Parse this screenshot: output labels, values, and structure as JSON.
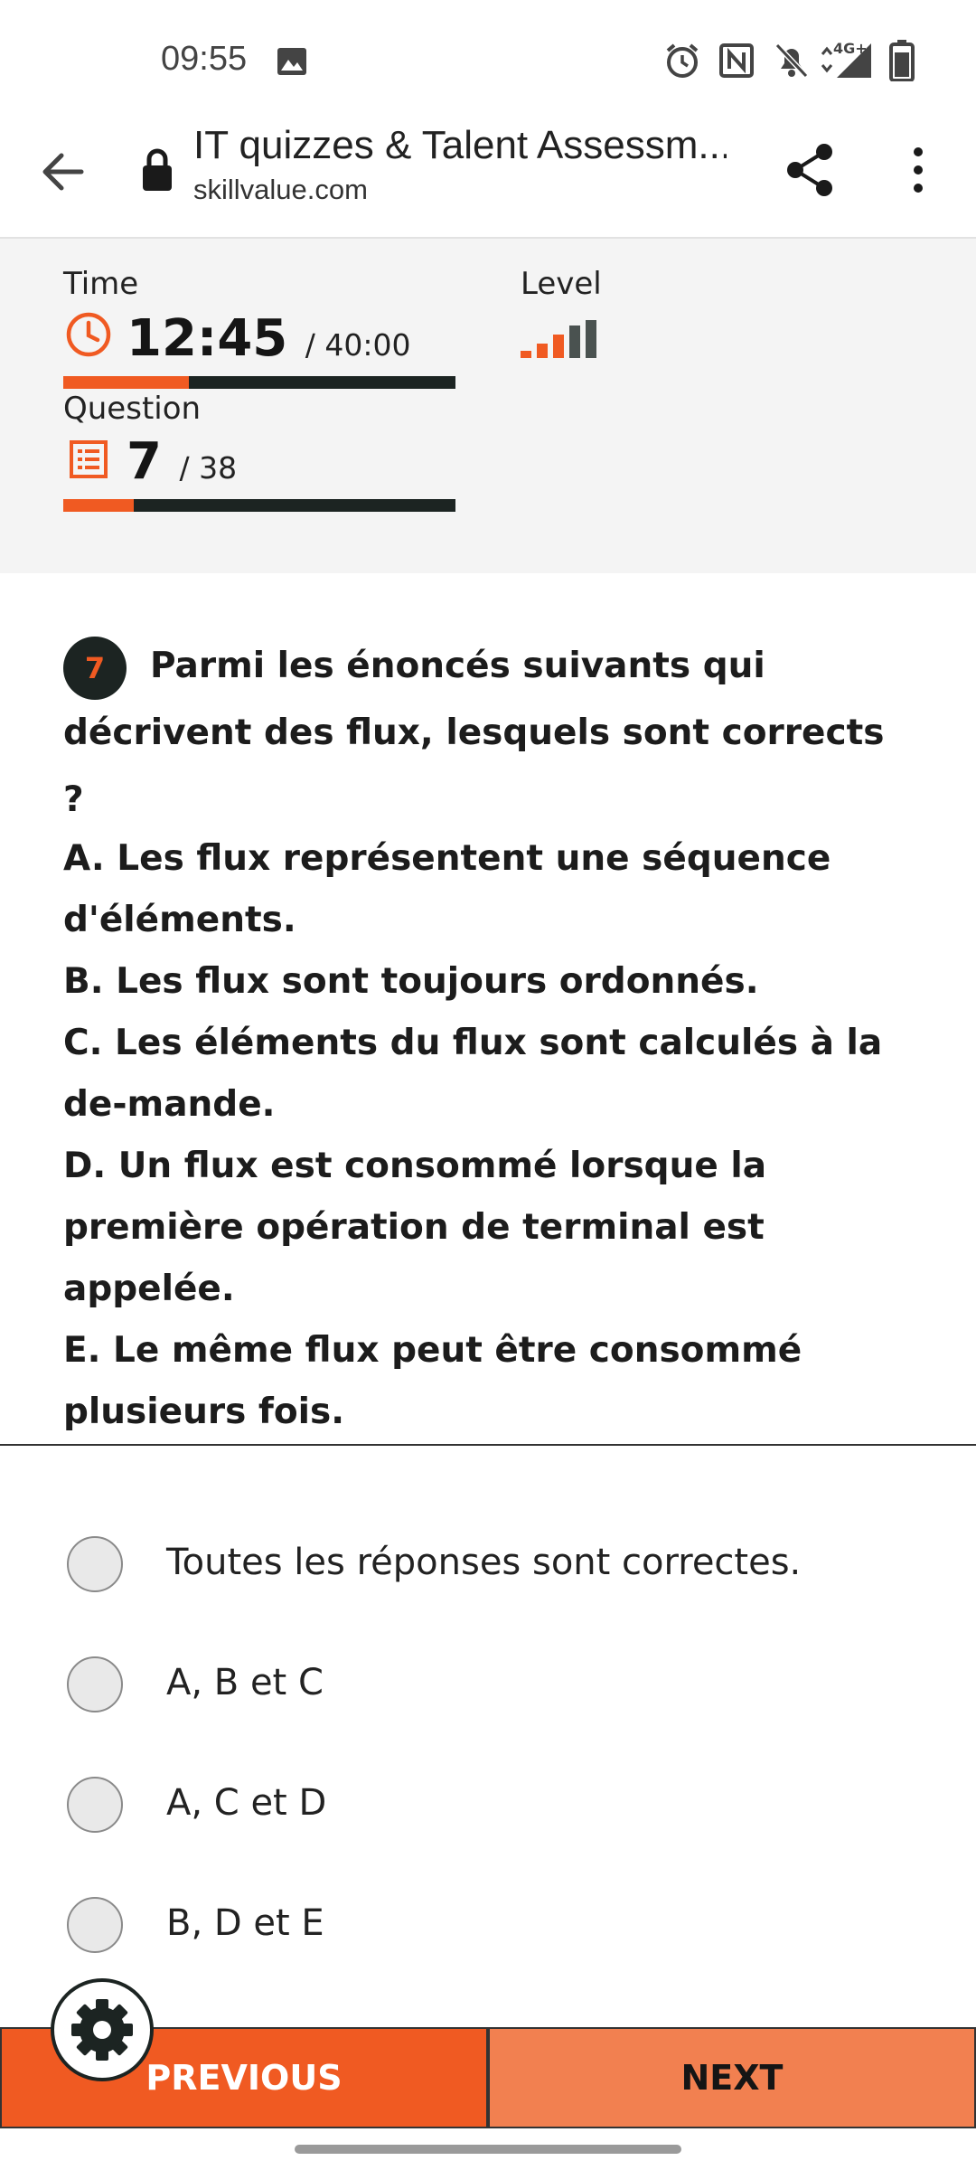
{
  "status_bar": {
    "time": "09:55",
    "icons": [
      "image-icon",
      "alarm-icon",
      "nfc-icon",
      "mute-icon",
      "network-4g-icon",
      "battery-icon"
    ],
    "network_label": "4G+"
  },
  "browser": {
    "title": "IT quizzes & Talent Assessm...",
    "url": "skillvalue.com"
  },
  "stats": {
    "time_label": "Time",
    "time_value": "12:45",
    "time_total": "/ 40:00",
    "time_progress": 0.32,
    "level_label": "Level",
    "level_active": 3,
    "level_total": 5,
    "question_label": "Question",
    "question_value": "7",
    "question_total": "/ 38",
    "question_progress": 0.18
  },
  "question": {
    "number": "7",
    "text": "Parmi les énoncés suivants qui décrivent des flux, lesquels sont corrects ?",
    "statements": [
      "A. Les flux représentent une séquence d'éléments.",
      "B. Les flux sont toujours ordonnés.",
      "C. Les éléments du flux sont calculés à la de-mande.",
      "D. Un flux est consommé lorsque la première opération de terminal est appelée.",
      "E. Le même flux peut être consommé plusieurs fois."
    ]
  },
  "answers": [
    "Toutes les réponses sont correctes.",
    "A, B et C",
    "A, C et D",
    "B, D et E"
  ],
  "buttons": {
    "previous": "PREVIOUS",
    "next": "NEXT"
  },
  "colors": {
    "accent": "#f05a22",
    "accent_light": "#f28050",
    "dark": "#1c2422",
    "panel": "#f4f4f4"
  }
}
